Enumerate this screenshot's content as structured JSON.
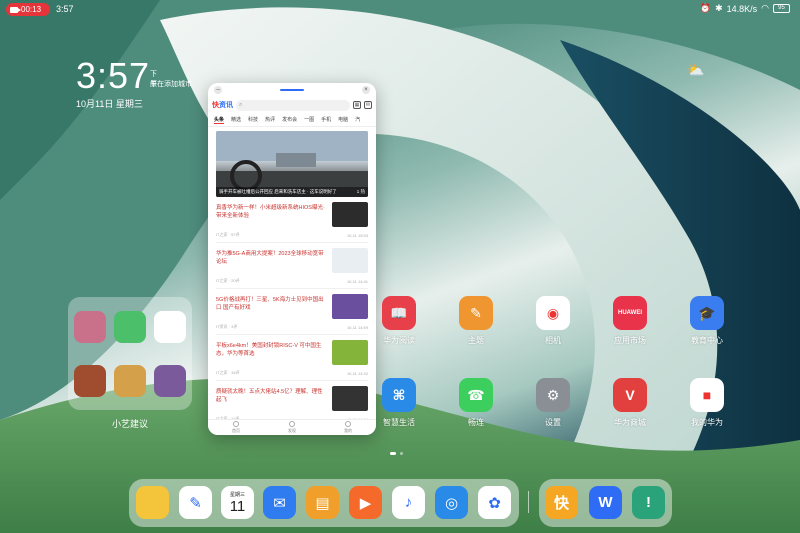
{
  "status_bar": {
    "recording_time": "00:13",
    "time": "3:57",
    "network_speed": "14.8K/s",
    "battery": "95"
  },
  "clock": {
    "time": "3:57",
    "ampm": "下午",
    "city": "原在添加城市",
    "date": "10月11日 星期三"
  },
  "browser_window": {
    "logo_red": "快",
    "logo_blue": "资讯",
    "search_placeholder": "Q",
    "channels": [
      "头条",
      "精选",
      "科技",
      "热评",
      "发布会",
      "一图",
      "手机",
      "电脑",
      "汽"
    ],
    "hero_caption": "骑手开车被吐槽后公开回应 后来和洗车店主 · 这车说明好了",
    "hero_time": "1 热",
    "news": [
      {
        "title": "真香华为新一样！小米超级新系统HIOS曝光·带来全新体验",
        "meta": "IT之家 · 57评",
        "time": "10-11 15:53",
        "thumb_color": "#2c2c2c"
      },
      {
        "title": "华为推5G-A商用大提案！2023全球移动宽带论坛",
        "meta": "IT之家 · 20评",
        "time": "10-11 14:41",
        "thumb_color": "#e9eef2"
      },
      {
        "title": "5G价格战再打！三星、5K海力士见到中国出口 国产有好戏",
        "meta": "IT资讯 · 3评",
        "time": "10-11 14:59",
        "thumb_color": "#6a4f9e"
      },
      {
        "title": "平板x6e4km！美国封封锁RISC-V 可中国生态，华为等首选",
        "meta": "IT之家 · 34评",
        "time": "10-11 14:32",
        "thumb_color": "#84b43a"
      },
      {
        "title": "质疑就太晚！五点大佬站4.5亿？理解、理性起飞",
        "meta": "IT之家 · 11评",
        "time": "10-11 14:04",
        "thumb_color": "#333"
      }
    ],
    "bottom_tabs": [
      "首页",
      "发现",
      "我的"
    ]
  },
  "folder": {
    "label": "小艺建议",
    "apps": [
      {
        "name": "game-app-1",
        "color": "#c9708a"
      },
      {
        "name": "green-app",
        "color": "#4cbf6a"
      },
      {
        "name": "qq-app",
        "color": "#ffffff"
      },
      {
        "name": "game-app-2",
        "color": "#a04c2e"
      },
      {
        "name": "game-app-3",
        "color": "#d4a04a"
      },
      {
        "name": "game-app-4",
        "color": "#7a5a9a"
      }
    ]
  },
  "apps": {
    "row1": [
      {
        "label": "华为阅读",
        "color": "#e8404a",
        "glyph": "📖"
      },
      {
        "label": "主题",
        "color": "#f09630",
        "glyph": "✎"
      },
      {
        "label": "相机",
        "color": "#ffffff",
        "glyph": "◉"
      },
      {
        "label": "应用市场",
        "color": "#e8334a",
        "glyph": "HUAWEI"
      },
      {
        "label": "教育中心",
        "color": "#3a7df0",
        "glyph": "🎓"
      }
    ],
    "row2": [
      {
        "label": "智慧生活",
        "color": "#2a8ae8",
        "glyph": "⌘"
      },
      {
        "label": "畅连",
        "color": "#3ccf5e",
        "glyph": "☎"
      },
      {
        "label": "设置",
        "color": "#8a8f96",
        "glyph": "⚙"
      },
      {
        "label": "华为商城",
        "color": "#e23f3f",
        "glyph": "V"
      },
      {
        "label": "我的华为",
        "color": "#ffffff",
        "glyph": "■"
      }
    ]
  },
  "dock": {
    "calendar_weekday": "星期三",
    "calendar_day": "11",
    "apps": [
      {
        "name": "wallet-app",
        "color": "#f4c43a",
        "glyph": ""
      },
      {
        "name": "notes-app",
        "color": "#ffffff",
        "glyph": "✎"
      },
      {
        "name": "calendar-app",
        "color": "#ffffff",
        "glyph": ""
      },
      {
        "name": "mail-app",
        "color": "#2f7cf0",
        "glyph": "✉"
      },
      {
        "name": "docs-app",
        "color": "#f0a02a",
        "glyph": "▤"
      },
      {
        "name": "video-app",
        "color": "#f56a2a",
        "glyph": "▶"
      },
      {
        "name": "music-app",
        "color": "#ffffff",
        "glyph": "♪"
      },
      {
        "name": "browser-app",
        "color": "#2a8ae8",
        "glyph": "◎"
      },
      {
        "name": "gallery-app",
        "color": "#ffffff",
        "glyph": "✿"
      },
      {
        "name": "kuaishou-app",
        "color": "#f5a623",
        "glyph": "快"
      },
      {
        "name": "wps-app",
        "color": "#2f6cf5",
        "glyph": "W"
      },
      {
        "name": "tips-app",
        "color": "#2aa37a",
        "glyph": "!"
      }
    ]
  }
}
